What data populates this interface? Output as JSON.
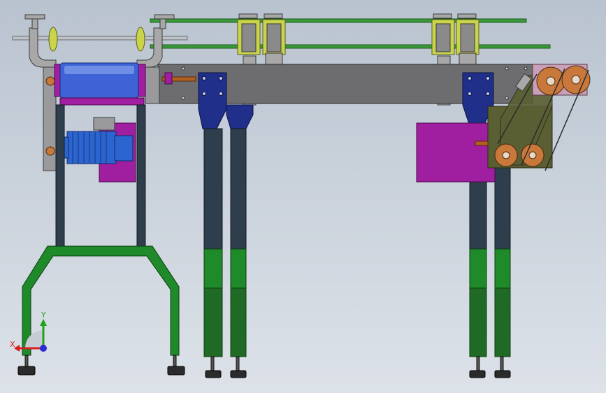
{
  "view": {
    "background_top": "#b9c3cf",
    "background_bottom": "#dde2e9"
  },
  "triad": {
    "x_label": "X",
    "y_label": "Y",
    "x_color": "#d42020",
    "y_color": "#1fa31f",
    "z_color": "#2a2ad6"
  },
  "colors": {
    "frame_plate": "#6d6d70",
    "leg_dark": "#2e3e4c",
    "leg_green": "#1f8a2a",
    "leg_green_dark": "#1f6b26",
    "rail_green": "#3a9a3a",
    "bracket_yellow": "#c9d44a",
    "clamp_grey": "#a8a8a8",
    "drum_blue": "#3d63d6",
    "motor_blue": "#2c64d0",
    "magenta": "#a01fa0",
    "gusset_navy": "#1f2f8a",
    "sprocket_orange": "#c8783a",
    "foot_dark": "#2b2b2b"
  },
  "icons": {
    "triad": "coordinate-triad-icon",
    "sprocket": "sprocket-icon",
    "motor": "motor-icon",
    "leveling_foot": "leveling-foot-icon"
  }
}
